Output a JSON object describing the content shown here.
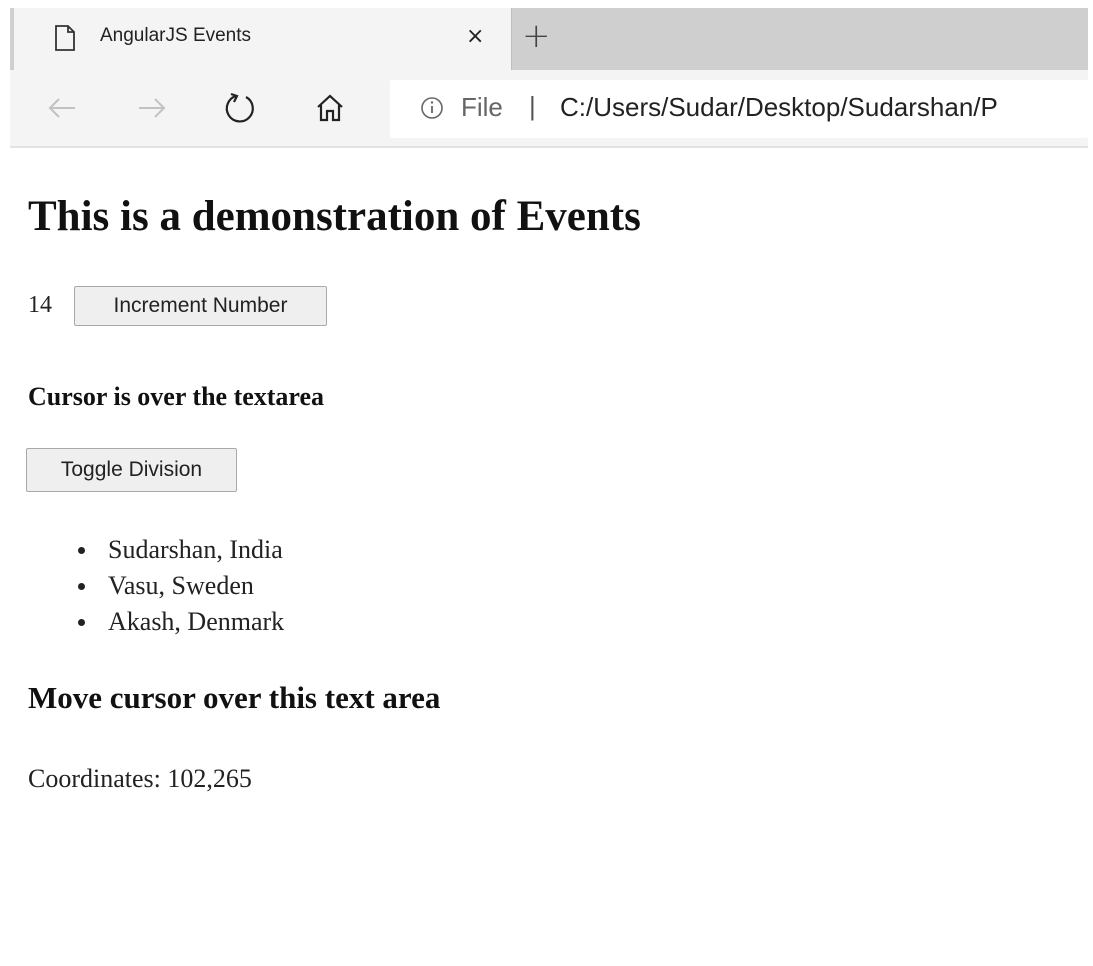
{
  "browser": {
    "tab_title": "AngularJS Events",
    "tab_close": "×",
    "new_tab": "+",
    "address": {
      "scheme_label": "File",
      "separator": "|",
      "url": "C:/Users/Sudar/Desktop/Sudarshan/P"
    },
    "icons": {
      "tab": "document-icon",
      "back": "back-arrow-icon",
      "forward": "forward-arrow-icon",
      "reload": "reload-icon",
      "home": "home-icon",
      "info": "info-icon"
    }
  },
  "page": {
    "title": "This is a demonstration of Events",
    "counter": {
      "value": "14",
      "button_label": "Increment Number"
    },
    "status_message": "Cursor is over the textarea",
    "toggle_button_label": "Toggle Division",
    "people": [
      "Sudarshan, India",
      "Vasu, Sweden",
      "Akash, Denmark"
    ],
    "hover_heading": "Move cursor over this text area",
    "coordinates": "Coordinates: 102,265"
  }
}
